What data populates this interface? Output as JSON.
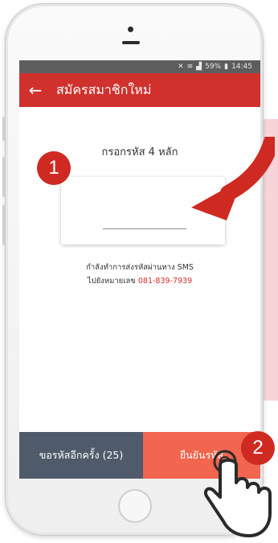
{
  "status_bar": {
    "battery_percent": "59%",
    "time": "14:45",
    "icons": [
      "mute-icon",
      "wifi-icon",
      "signal-icon",
      "battery-icon"
    ]
  },
  "app_bar": {
    "back_icon": "arrow-left-icon",
    "title": "สมัครสมาชิกใหม่"
  },
  "content": {
    "code_heading": "กรอกรหัส 4 หลัก",
    "code_input": {
      "value": "",
      "placeholder": ""
    },
    "sms_line1": "กำลังทำการส่งรหัสผ่านทาง SMS",
    "sms_line2_prefix": "ไปยังหมายเลข",
    "phone_number": "081-839-7939"
  },
  "buttons": {
    "resend": "ขอรหัสอีกครั้ง (25)",
    "confirm": "ยืนยันรหัส"
  },
  "callouts": {
    "step1": "1",
    "step2": "2"
  },
  "colors": {
    "app_bar": "#d0312d",
    "resend_button": "#4f5b6a",
    "confirm_button": "#f2654e",
    "callout": "#cf2a22",
    "phone_number": "#d0312d"
  }
}
